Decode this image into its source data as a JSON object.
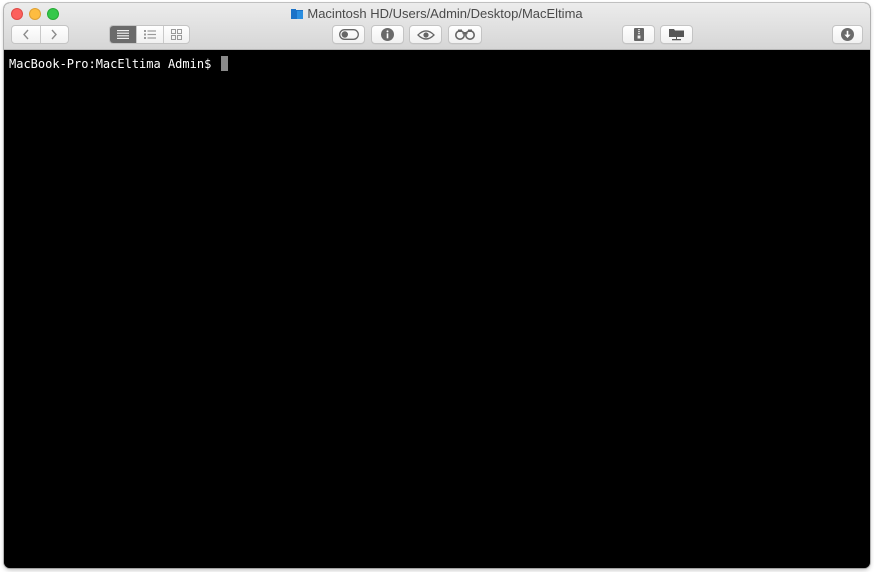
{
  "window": {
    "title": "Macintosh HD/Users/Admin/Desktop/MacEltima"
  },
  "toolbar": {
    "back_icon": "chevron-left-icon",
    "forward_icon": "chevron-right-icon",
    "view_modes": [
      "list-view-icon",
      "detail-view-icon",
      "grid-view-icon"
    ],
    "active_view": "list-view-icon",
    "actions_center": [
      "toggle-icon",
      "info-icon",
      "eye-icon",
      "binoculars-icon"
    ],
    "actions_right": [
      "archive-icon",
      "terminal-icon"
    ],
    "download_icon": "download-icon"
  },
  "terminal": {
    "prompt": "MacBook-Pro:MacEltima Admin$ "
  },
  "colors": {
    "close": "#fc605c",
    "minimize": "#fdbc40",
    "zoom": "#34c84a",
    "terminal_bg": "#000000",
    "terminal_fg": "#ffffff"
  }
}
